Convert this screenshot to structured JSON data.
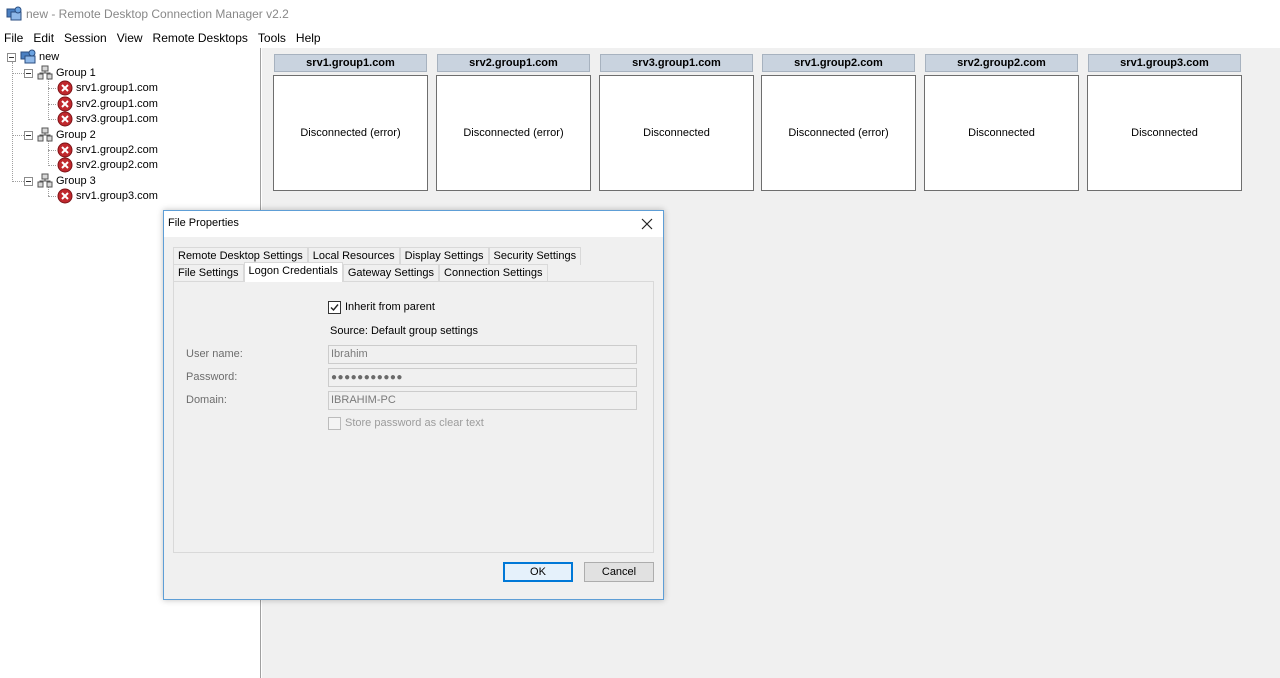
{
  "window": {
    "title": "new - Remote Desktop Connection Manager v2.2"
  },
  "menu": [
    "File",
    "Edit",
    "Session",
    "View",
    "Remote Desktops",
    "Tools",
    "Help"
  ],
  "tree": {
    "root": "new",
    "groups": [
      {
        "label": "Group 1",
        "servers": [
          "srv1.group1.com",
          "srv2.group1.com",
          "srv3.group1.com"
        ]
      },
      {
        "label": "Group 2",
        "servers": [
          "srv1.group2.com",
          "srv2.group2.com"
        ]
      },
      {
        "label": "Group 3",
        "servers": [
          "srv1.group3.com"
        ]
      }
    ]
  },
  "thumbnails": [
    {
      "title": "srv1.group1.com",
      "status": "Disconnected (error)"
    },
    {
      "title": "srv2.group1.com",
      "status": "Disconnected (error)"
    },
    {
      "title": "srv3.group1.com",
      "status": "Disconnected"
    },
    {
      "title": "srv1.group2.com",
      "status": "Disconnected (error)"
    },
    {
      "title": "srv2.group2.com",
      "status": "Disconnected"
    },
    {
      "title": "srv1.group3.com",
      "status": "Disconnected"
    }
  ],
  "dialog": {
    "title": "File Properties",
    "tabs_row1": [
      "Remote Desktop Settings",
      "Local Resources",
      "Display Settings",
      "Security Settings"
    ],
    "tabs_row2": [
      "File Settings",
      "Logon Credentials",
      "Gateway Settings",
      "Connection Settings"
    ],
    "active_tab": "Logon Credentials",
    "inherit_label": "Inherit from parent",
    "inherit_checked": true,
    "source_text": "Source: Default group settings",
    "username_label": "User name:",
    "username_value": "Ibrahim",
    "password_label": "Password:",
    "password_value": "●●●●●●●●●●●",
    "domain_label": "Domain:",
    "domain_value": "IBRAHIM-PC",
    "store_password_label": "Store password as clear text",
    "store_password_checked": false,
    "ok_label": "OK",
    "cancel_label": "Cancel"
  },
  "colors": {
    "error_icon": "#c0282d",
    "thumb_title_bg": "#c9d3df",
    "dialog_border": "#5e9ed6",
    "accent": "#0078d7"
  }
}
